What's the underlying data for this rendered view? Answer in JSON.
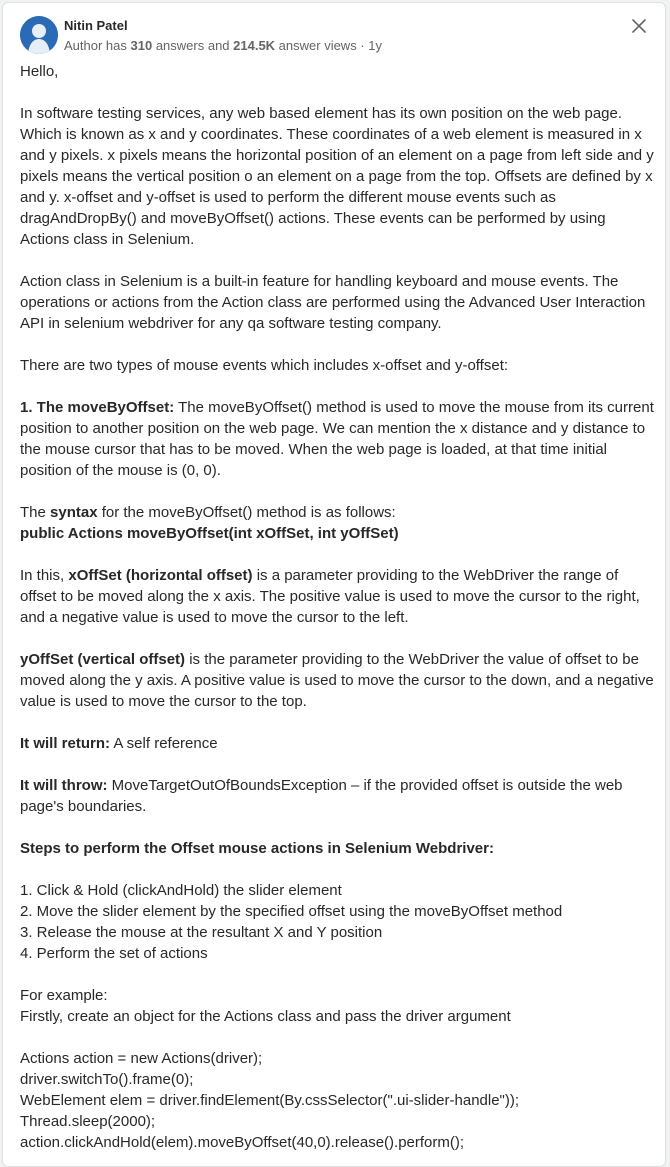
{
  "author": {
    "name": "Nitin Patel",
    "meta_prefix": "Author has ",
    "answers_count": "310",
    "answers_label": " answers and ",
    "views_count": "214.5K",
    "views_label": " answer views",
    "separator": " · ",
    "time_ago": "1y"
  },
  "icons": {
    "close": "close-icon",
    "avatar": "avatar-silhouette"
  },
  "colors": {
    "avatar_bg": "#2b6bb5",
    "text": "#282829",
    "meta": "#636466"
  },
  "answer": {
    "greeting": "Hello,",
    "para1": "In software testing services, any web based element has its own position on the web page. Which is known as x and y coordinates. These coordinates of a web element is measured in x and y pixels. x pixels means the horizontal position of an element on a page from left side and y pixels means the vertical position o an element on a page from the top. Offsets are defined by x and y. x-offset and y-offset is used to perform the different mouse events such as dragAndDropBy() and moveByOffset() actions. These events can be performed by using Actions class in Selenium.",
    "para2": "Action class in Selenium is a built-in feature for handling keyboard and mouse events. The operations or actions from the Action class are performed using the Advanced User Interaction API in selenium webdriver for any qa software testing company.",
    "para3": "There are two types of mouse events which includes x-offset and y-offset:",
    "move_heading": "1. The moveByOffset:",
    "move_text": " The moveByOffset() method is used to move the mouse from its current position to another position on the web page. We can mention the x distance and y distance to the mouse cursor that has to be moved. When the web page is loaded, at that time initial position of the mouse is (0, 0).",
    "syntax_pre": "The ",
    "syntax_bold": "syntax",
    "syntax_post": " for the moveByOffset() method is as follows:",
    "syntax_code": "public Actions moveByOffset(int xOffSet, int yOffSet)",
    "xoff_pre": "In this, ",
    "xoff_bold": "xOffSet (horizontal offset)",
    "xoff_text": " is a parameter providing to the WebDriver the range of offset to be moved along the x axis. The positive value is used to move the cursor to the right, and a negative value is used to move the cursor to the left.",
    "yoff_bold": "yOffSet (vertical offset)",
    "yoff_text": " is the parameter providing to the WebDriver the value of offset to be moved along the y axis. A positive value is used to move the cursor to the down, and a negative value is used to move the cursor to the top.",
    "return_bold": "It will return:",
    "return_text": " A self reference",
    "throw_bold": "It will throw:",
    "throw_text": " MoveTargetOutOfBoundsException – if the provided offset is outside the web page's boundaries.",
    "steps_heading": "Steps to perform the Offset mouse actions in Selenium Webdriver:",
    "steps": [
      "1. Click & Hold (clickAndHold) the slider element",
      "2. Move the slider element by the specified offset using the moveByOffset method",
      "3. Release the mouse at the resultant X and Y position",
      "4. Perform the set of actions"
    ],
    "example_label": "For example:",
    "example_text": "Firstly, create an object for the Actions class and pass the driver argument",
    "code": [
      "Actions action = new Actions(driver);",
      "driver.switchTo().frame(0);",
      "WebElement elem = driver.findElement(By.cssSelector(\".ui-slider-handle\"));",
      "Thread.sleep(2000);",
      "action.clickAndHold(elem).moveByOffset(40,0).release().perform();"
    ]
  }
}
